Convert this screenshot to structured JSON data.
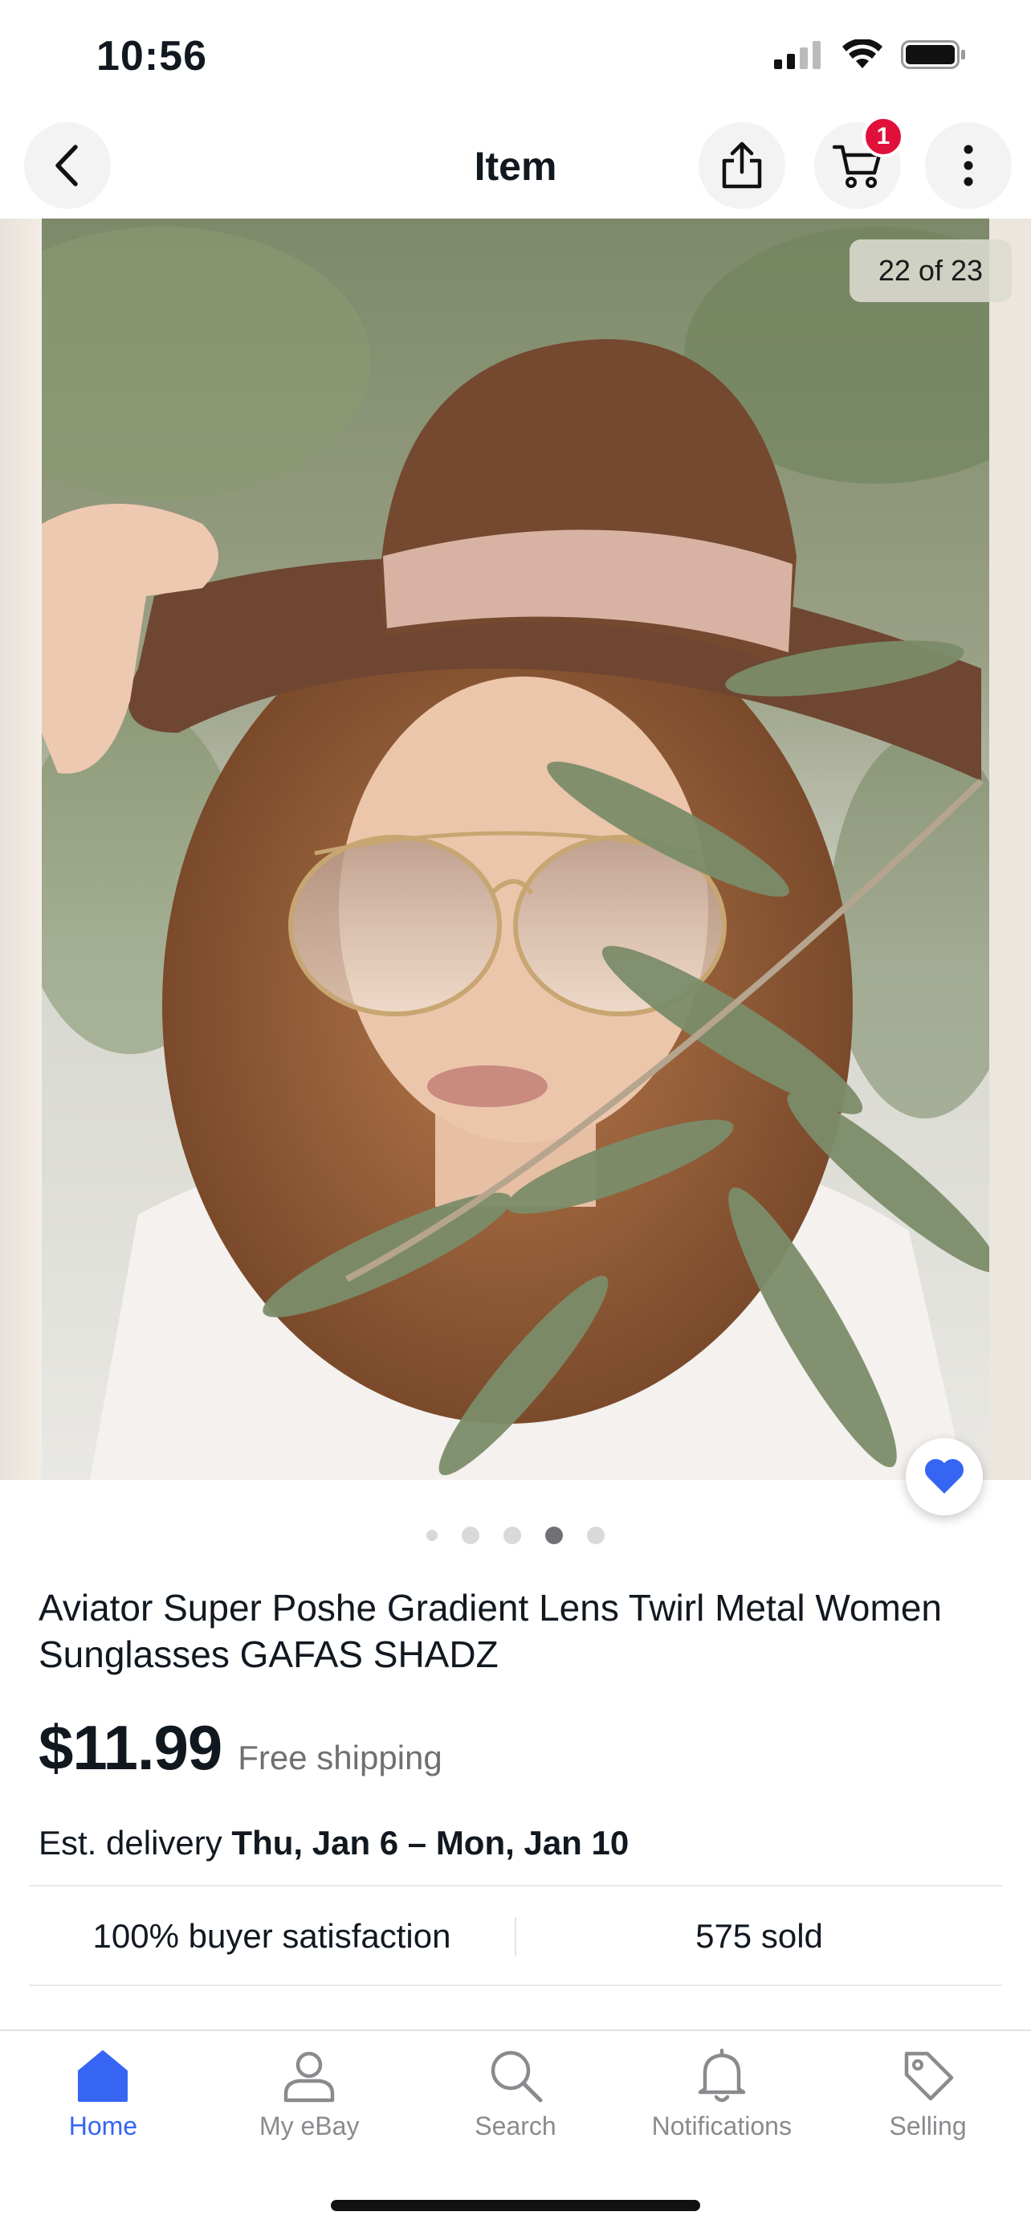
{
  "status_bar": {
    "time": "10:56"
  },
  "header": {
    "title": "Item",
    "cart_count": "1"
  },
  "gallery": {
    "counter": "22 of 23",
    "dot_count": 5,
    "active_dot": 3
  },
  "item": {
    "title": "Aviator Super Poshe Gradient Lens Twirl Metal Women Sunglasses GAFAS SHADZ",
    "price": "$11.99",
    "shipping": "Free shipping",
    "delivery_label": "Est. delivery",
    "delivery_dates": "Thu, Jan 6 – Mon, Jan 10",
    "satisfaction": "100% buyer satisfaction",
    "sold": "575 sold"
  },
  "tabs": [
    {
      "label": "Home",
      "icon": "home-icon",
      "active": true
    },
    {
      "label": "My eBay",
      "icon": "person-icon",
      "active": false
    },
    {
      "label": "Search",
      "icon": "search-icon",
      "active": false
    },
    {
      "label": "Notifications",
      "icon": "bell-icon",
      "active": false
    },
    {
      "label": "Selling",
      "icon": "tag-icon",
      "active": false
    }
  ],
  "colors": {
    "accent": "#3665f3",
    "badge": "#e0103a",
    "text": "#111820",
    "muted": "#707070"
  }
}
